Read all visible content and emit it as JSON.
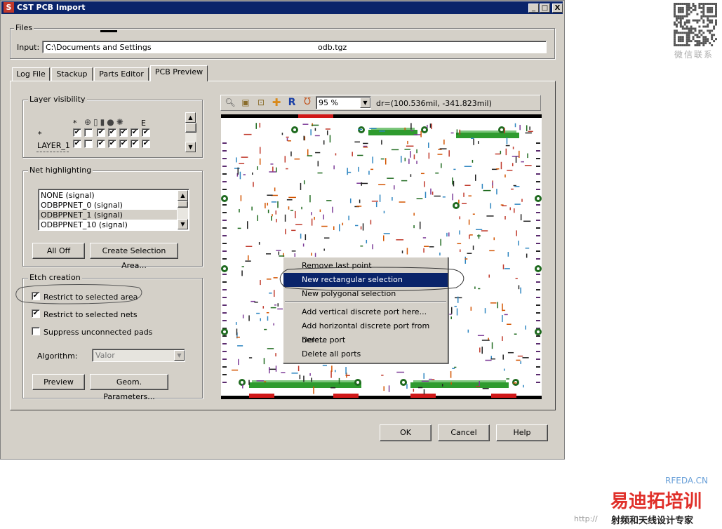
{
  "window": {
    "title": "CST PCB Import",
    "app_icon": "cst-s-icon",
    "controls": {
      "minimize": "_",
      "maximize": "□",
      "close": "X"
    }
  },
  "files": {
    "group_label": "Files",
    "input_label": "Input:",
    "input_value": "C:\\Documents and Settings",
    "input_value_tail": "odb.tgz"
  },
  "tabs": [
    {
      "label": "Log File",
      "active": false
    },
    {
      "label": "Stackup",
      "active": false
    },
    {
      "label": "Parts Editor",
      "active": false
    },
    {
      "label": "PCB Preview",
      "active": true
    }
  ],
  "layer_visibility": {
    "group_label": "Layer visibility",
    "header_marks": [
      "*",
      "E"
    ],
    "rows": [
      {
        "name": "*",
        "checks": [
          true,
          false,
          true,
          true,
          true,
          true,
          true
        ]
      },
      {
        "name": "LAYER_1",
        "checks": [
          true,
          false,
          true,
          true,
          true,
          true,
          true
        ]
      }
    ]
  },
  "net_highlighting": {
    "group_label": "Net highlighting",
    "items": [
      "NONE (signal)",
      "ODBPPNET_0 (signal)",
      "ODBPPNET_1 (signal)",
      "ODBPPNET_10 (signal)"
    ],
    "selected_index": 2,
    "all_off": "All Off",
    "create_selection": "Create Selection Area..."
  },
  "etch_creation": {
    "group_label": "Etch creation",
    "options": [
      {
        "label": "Restrict to selected area",
        "checked": true
      },
      {
        "label": "Restrict to selected nets",
        "checked": true
      },
      {
        "label": "Suppress unconnected pads",
        "checked": false
      }
    ],
    "algorithm_label": "Algorithm:",
    "algorithm_value": "Valor",
    "preview": "Preview",
    "geom_params": "Geom. Parameters..."
  },
  "preview_toolbar": {
    "zoom": "95 %",
    "coords": "dr=(100.536mil, -341.823mil)",
    "icons": [
      "zoom-icon",
      "zoom-fit-icon",
      "zoom-region-icon",
      "pan-icon",
      "reset-icon",
      "magnet-icon"
    ],
    "reset_glyph": "R"
  },
  "context_menu": {
    "items": [
      {
        "label": "Remove last point",
        "selected": false,
        "sep_after": false
      },
      {
        "label": "New rectangular selection",
        "selected": true,
        "sep_after": false
      },
      {
        "label": "New polygonal selection",
        "selected": false,
        "sep_after": true
      },
      {
        "label": "Add vertical discrete port here...",
        "selected": false,
        "sep_after": false
      },
      {
        "label": "Add horizontal discrete port from here...",
        "selected": false,
        "sep_after": false
      },
      {
        "label": "Delete port",
        "selected": false,
        "sep_after": false
      },
      {
        "label": "Delete all ports",
        "selected": false,
        "sep_after": false
      }
    ]
  },
  "footer": {
    "ok": "OK",
    "cancel": "Cancel",
    "help": "Help"
  },
  "watermark": {
    "qr_caption": "微信联系",
    "site": "RFEDA.CN",
    "brand": "易迪拓培训",
    "tagline": "射频和天线设计专家",
    "url": "http://"
  },
  "colors": {
    "titlebar": "#0a246a",
    "dialog_bg": "#d4d0c8",
    "menu_highlight": "#0a246a",
    "pcb_green": "#2e9b2e",
    "pcb_red": "#d01818",
    "brand_red": "#e0302a"
  }
}
